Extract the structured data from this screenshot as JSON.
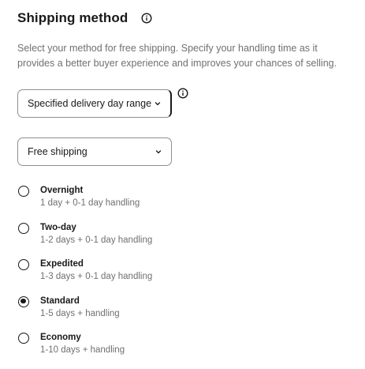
{
  "section": {
    "title": "Shipping method",
    "description": "Select your method for free shipping. Specify your handling time as it provides a better buyer experience and improves your chances of selling."
  },
  "selects": {
    "delivery_range": "Specified delivery day range",
    "shipping_type": "Free shipping"
  },
  "options": [
    {
      "name": "Overnight",
      "detail": "1 day + 0-1 day handling",
      "selected": false
    },
    {
      "name": "Two-day",
      "detail": "1-2 days + 0-1 day handling",
      "selected": false
    },
    {
      "name": "Expedited",
      "detail": "1-3 days + 0-1 day handling",
      "selected": false
    },
    {
      "name": "Standard",
      "detail": "1-5 days + handling",
      "selected": true
    },
    {
      "name": "Economy",
      "detail": "1-10 days + handling",
      "selected": false
    }
  ],
  "icons": {
    "title_info": "info-icon",
    "select_info": "info-icon",
    "select_arrow": "chevron-down-icon"
  },
  "colors": {
    "text": "#191919",
    "muted": "#707070",
    "border": "#8f8f8f"
  }
}
